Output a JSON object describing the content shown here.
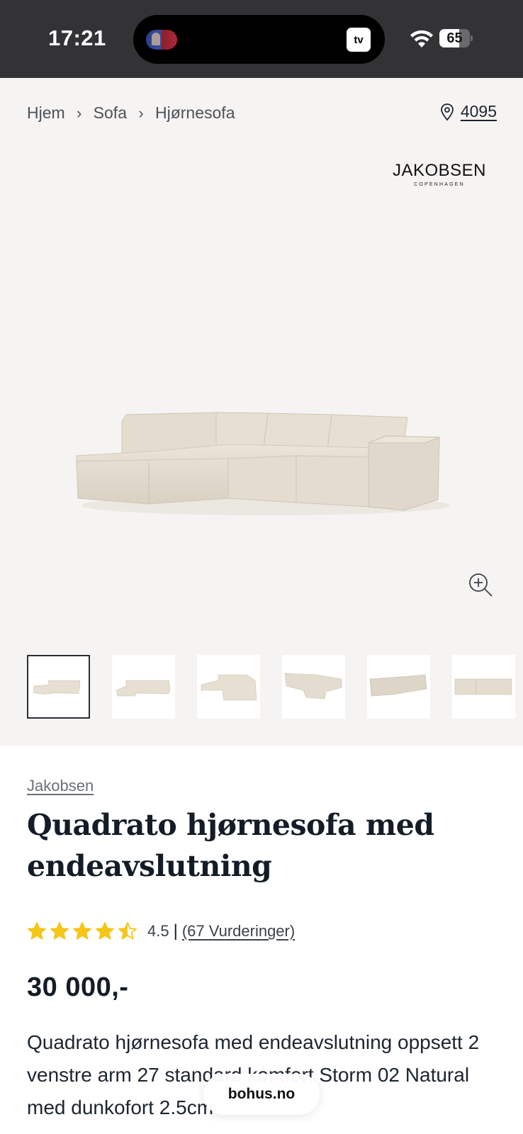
{
  "status_bar": {
    "time": "17:21",
    "tv_label": "tv",
    "battery_level": "65",
    "icons": [
      "now-playing-art",
      "apple-tv-icon",
      "wifi-icon",
      "battery-icon"
    ]
  },
  "breadcrumb": {
    "items": [
      "Hjem",
      "Sofa",
      "Hjørnesofa"
    ],
    "separator_icon": "chevron-right-icon"
  },
  "store": {
    "icon": "location-pin-icon",
    "number": "4095"
  },
  "gallery": {
    "brand_logo": {
      "main": "JAKOBSEN",
      "sub": "COPENHAGEN"
    },
    "zoom_icon": "zoom-in-icon",
    "thumbnail_count": 6,
    "active_thumbnail": 1
  },
  "product": {
    "brand": "Jakobsen",
    "title": "Quadrato hjørnesofa med endeavslutning",
    "rating": {
      "stars": 4.5,
      "value_text": "4.5",
      "separator": "|",
      "count_text": "(67 Vurderinger)"
    },
    "price": "30 000,-",
    "description": "Quadrato hjørnesofa med endeavslutning oppsett 2 venstre arm 27 standard komfort Storm 02 Natural med dunkofort 2.5cm"
  },
  "browser": {
    "site": "bohus.no"
  },
  "colors": {
    "status_bar_bg": "#333336",
    "gallery_bg": "#f6f4f2",
    "star": "#f5c518",
    "text_dark": "#141c27"
  }
}
